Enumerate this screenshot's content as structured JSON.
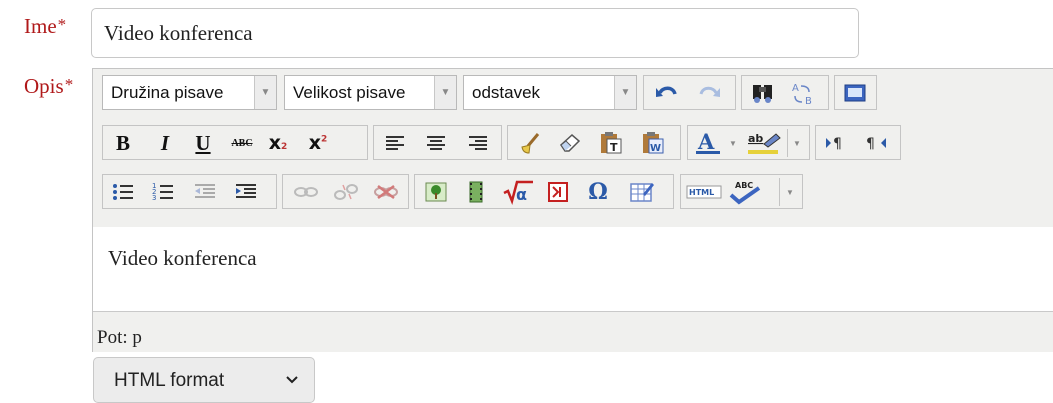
{
  "form": {
    "name_label": "Ime",
    "required_mark": "*",
    "name_value": "Video konferenca",
    "description_label": "Opis"
  },
  "toolbar": {
    "font_family": "Družina pisave",
    "font_size": "Velikost pisave",
    "block_format": "odstavek",
    "buttons_row1": [
      "undo-icon",
      "redo-icon",
      "find-icon",
      "replace-icon",
      "fullscreen-icon"
    ],
    "buttons_row2": [
      "bold-icon",
      "italic-icon",
      "underline-icon",
      "strikethrough-icon",
      "subscript-icon",
      "superscript-icon",
      "align-left-icon",
      "align-center-icon",
      "align-right-icon",
      "cleanup-icon",
      "remove-format-icon",
      "paste-text-icon",
      "paste-word-icon",
      "text-color-icon",
      "highlight-color-icon",
      "ltr-icon",
      "rtl-icon"
    ],
    "buttons_row3": [
      "bullet-list-icon",
      "numbered-list-icon",
      "outdent-icon",
      "indent-icon",
      "link-icon",
      "unlink-icon",
      "anchor-icon",
      "image-icon",
      "media-icon",
      "equation-icon",
      "nolink-icon",
      "special-char-icon",
      "table-icon",
      "html-source-icon",
      "spellcheck-icon"
    ]
  },
  "editor": {
    "content": "Video konferenca",
    "path": "Pot: p"
  },
  "format_select": {
    "label": "HTML format"
  },
  "colors": {
    "label_red": "#b0191a",
    "toolbar_bg": "#f0f0ee",
    "icon_blue": "#2b5aa8"
  }
}
